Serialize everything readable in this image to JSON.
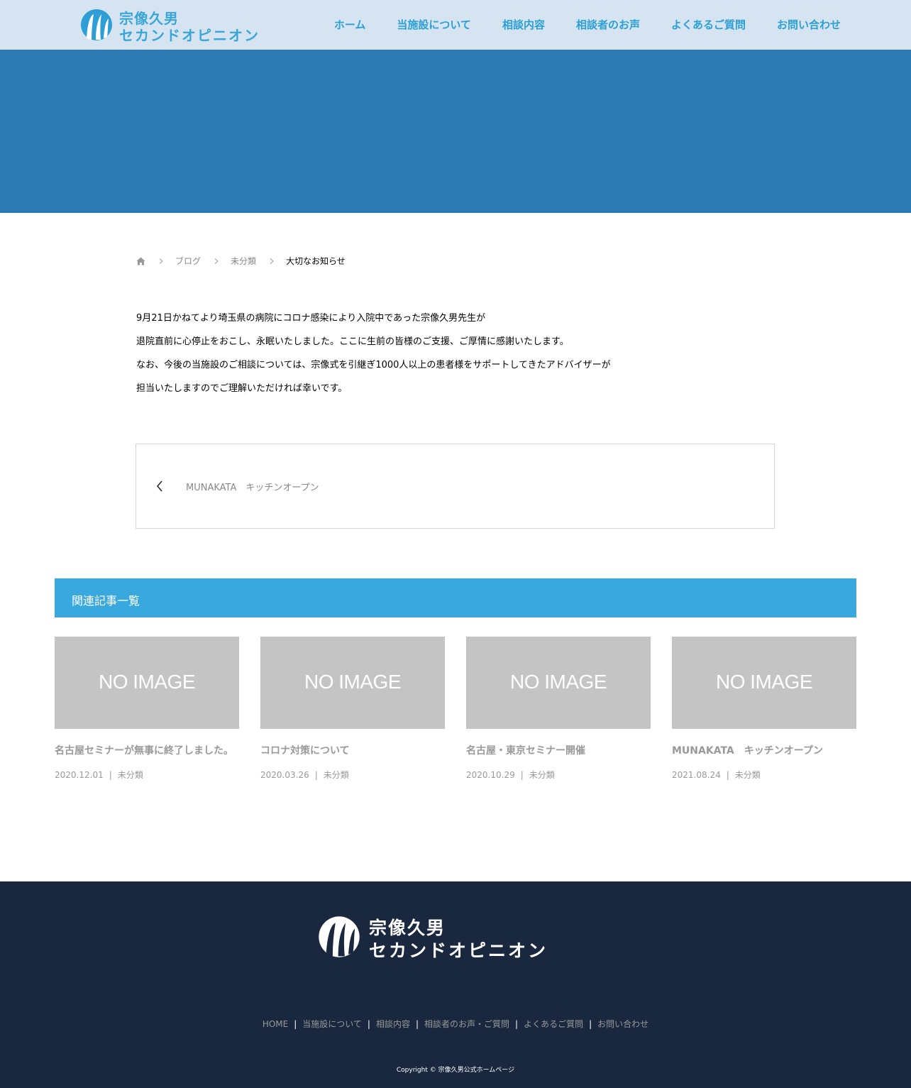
{
  "header": {
    "logo_line1": "宗像久男",
    "logo_line2": "セカンドオピニオン",
    "nav": [
      "ホーム",
      "当施設について",
      "相談内容",
      "相談者のお声",
      "よくあるご質問",
      "お問い合わせ"
    ]
  },
  "breadcrumb": {
    "home_icon": "home-icon",
    "items": [
      "ブログ",
      "未分類"
    ],
    "current": "大切なお知らせ"
  },
  "article": {
    "paragraphs": [
      "9月21日かねてより埼玉県の病院にコロナ感染により入院中であった宗像久男先生が",
      "退院直前に心停止をおこし、永眠いたしました。ここに生前の皆様のご支援、ご厚情に感謝いたします。",
      "なお、今後の当施設のご相談については、宗像式を引継ぎ1000人以上の患者様をサポートしてきたアドバイザーが",
      "担当いたしますのでご理解いただければ幸いです。"
    ]
  },
  "prev_post": {
    "title": "MUNAKATA　キッチンオープン"
  },
  "related": {
    "heading": "関連記事一覧",
    "no_image_label": "NO IMAGE",
    "items": [
      {
        "title": "名古屋セミナーが無事に終了しました。",
        "date": "2020.12.01",
        "category": "未分類"
      },
      {
        "title": "コロナ対策について",
        "date": "2020.03.26",
        "category": "未分類"
      },
      {
        "title": "名古屋・東京セミナー開催",
        "date": "2020.10.29",
        "category": "未分類"
      },
      {
        "title": "MUNAKATA　キッチンオープン",
        "date": "2021.08.24",
        "category": "未分類"
      }
    ]
  },
  "footer": {
    "logo_line1": "宗像久男",
    "logo_line2": "セカンドオピニオン",
    "nav": [
      "HOME",
      "当施設について",
      "相談内容",
      "相談者のお声・ご質問",
      "よくあるご質問",
      "お問い合わせ"
    ],
    "copyright": "Copyright © 宗像久男公式ホームページ"
  },
  "colors": {
    "header_bg": "#d6e4f2",
    "hero_bg": "#2b7ab1",
    "accent": "#38a8df",
    "footer_bg": "#19283e"
  }
}
